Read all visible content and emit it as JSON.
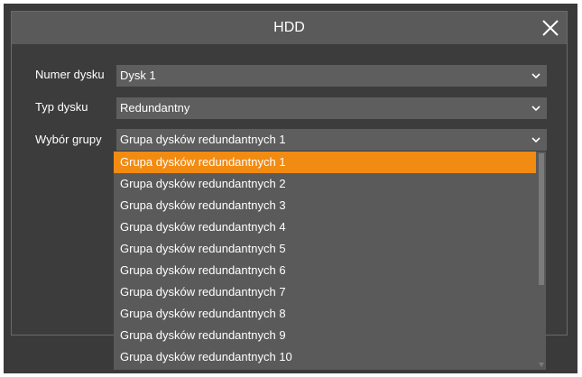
{
  "dialog": {
    "title": "HDD",
    "close_icon": "close-icon"
  },
  "form": {
    "disk_number": {
      "label": "Numer dysku",
      "value": "Dysk 1"
    },
    "disk_type": {
      "label": "Typ dysku",
      "value": "Redundantny"
    },
    "group_select": {
      "label": "Wybór grupy",
      "value": "Grupa dysków redundantnych 1"
    }
  },
  "dropdown": {
    "options": [
      "Grupa dysków redundantnych 1",
      "Grupa dysków redundantnych 2",
      "Grupa dysków redundantnych 3",
      "Grupa dysków redundantnych 4",
      "Grupa dysków redundantnych 5",
      "Grupa dysków redundantnych 6",
      "Grupa dysków redundantnych 7",
      "Grupa dysków redundantnych 8",
      "Grupa dysków redundantnych 9",
      "Grupa dysków redundantnych 10"
    ],
    "selected_index": 0
  },
  "colors": {
    "accent": "#f28b12",
    "dialog_bg": "#3c3c3c",
    "field_bg": "#5e5e5e"
  }
}
